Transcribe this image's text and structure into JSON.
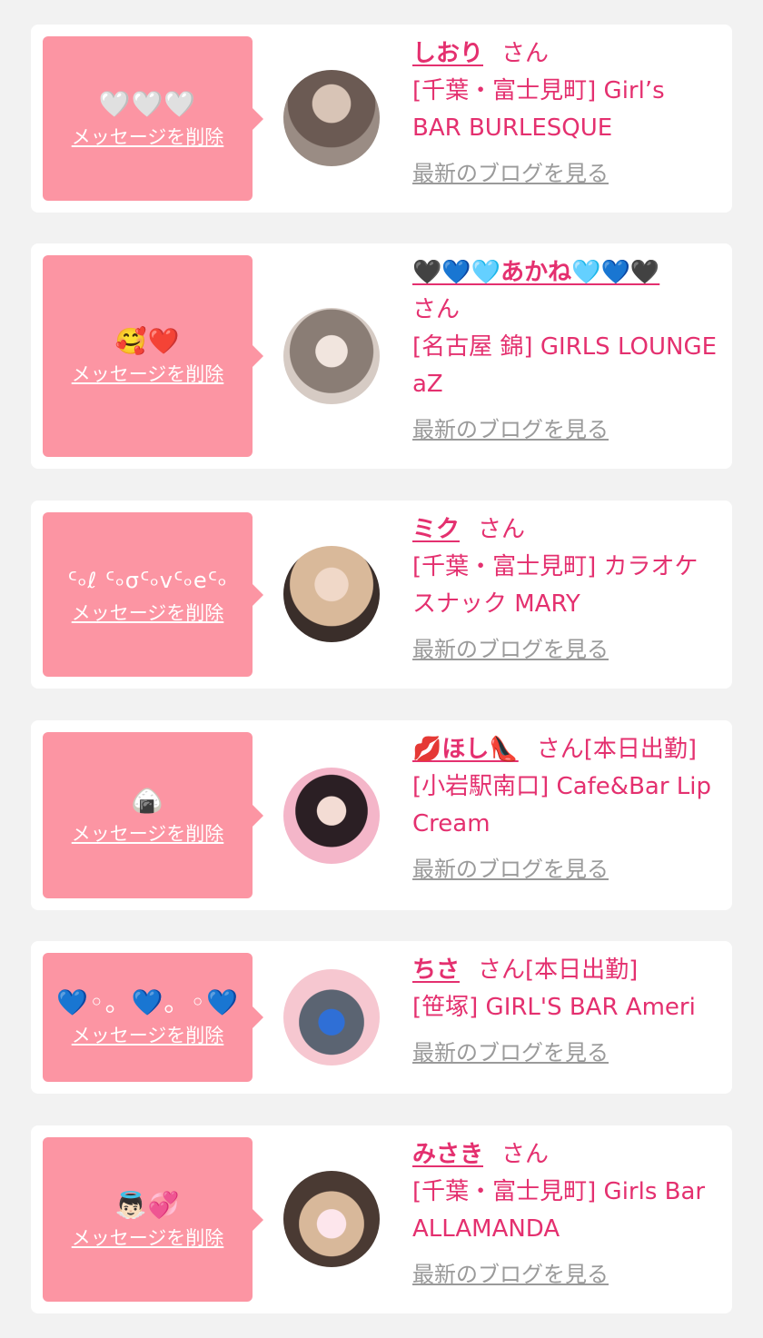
{
  "theme": {
    "accent": "#e4306f",
    "bubble": "#fc95a3",
    "link_gray": "#9a9a9a",
    "bg": "#f2f2f2"
  },
  "cards": [
    {
      "message": "🤍🤍🤍",
      "delete_label": "メッセージを削除",
      "name": "しおり",
      "suffix": "さん",
      "shop": "[千葉・富士見町] Girl’s BAR BURLESQUE",
      "blog_label": "最新のブログを見る",
      "avatar_icon": "photo-avatar-icon",
      "avatar_colors": [
        "#6b5a53",
        "#c9b6a8"
      ]
    },
    {
      "message": "🥰❤️",
      "delete_label": "メッセージを削除",
      "name": "🖤💙🩵あかね🩵💙🖤",
      "suffix": "さん",
      "shop": "[名古屋 錦] GIRLS LOUNGE aZ",
      "blog_label": "最新のブログを見る",
      "avatar_icon": "photo-avatar-icon",
      "avatar_colors": [
        "#7d7068",
        "#e8ddd6"
      ]
    },
    {
      "message": "ᑦ৹ℓ ᑦ৹σᑦ৹vᑦ৹eᑦ৹",
      "delete_label": "メッセージを削除",
      "name": "ミク",
      "suffix": "さん",
      "shop": "[千葉・富士見町] カラオケスナック MARY",
      "blog_label": "最新のブログを見る",
      "avatar_icon": "photo-avatar-icon",
      "avatar_colors": [
        "#3a2e2a",
        "#d9b99a"
      ]
    },
    {
      "message": "🍙",
      "delete_label": "メッセージを削除",
      "name": "💋ほし👠",
      "suffix": "さん[本日出勤]",
      "shop": "[小岩駅南口] Cafe&Bar Lip Cream",
      "blog_label": "最新のブログを見る",
      "avatar_icon": "photo-avatar-icon",
      "avatar_colors": [
        "#f4b6c9",
        "#2b1f24"
      ]
    },
    {
      "message": "💙◦。💙。◦💙",
      "delete_label": "メッセージを削除",
      "name": "ちさ",
      "suffix": "さん[本日出勤]",
      "shop": "[笹塚] GIRL'S BAR Ameri",
      "blog_label": "最新のブログを見る",
      "avatar_icon": "photo-avatar-icon",
      "avatar_colors": [
        "#f6c7d0",
        "#5b6472"
      ]
    },
    {
      "message": "👼🏻💞",
      "delete_label": "メッセージを削除",
      "name": "みさき",
      "suffix": "さん",
      "shop": "[千葉・富士見町] Girls Bar ALLAMANDA",
      "blog_label": "最新のブログを見る",
      "avatar_icon": "photo-avatar-icon",
      "avatar_colors": [
        "#4a3a33",
        "#d8b89a"
      ]
    }
  ]
}
